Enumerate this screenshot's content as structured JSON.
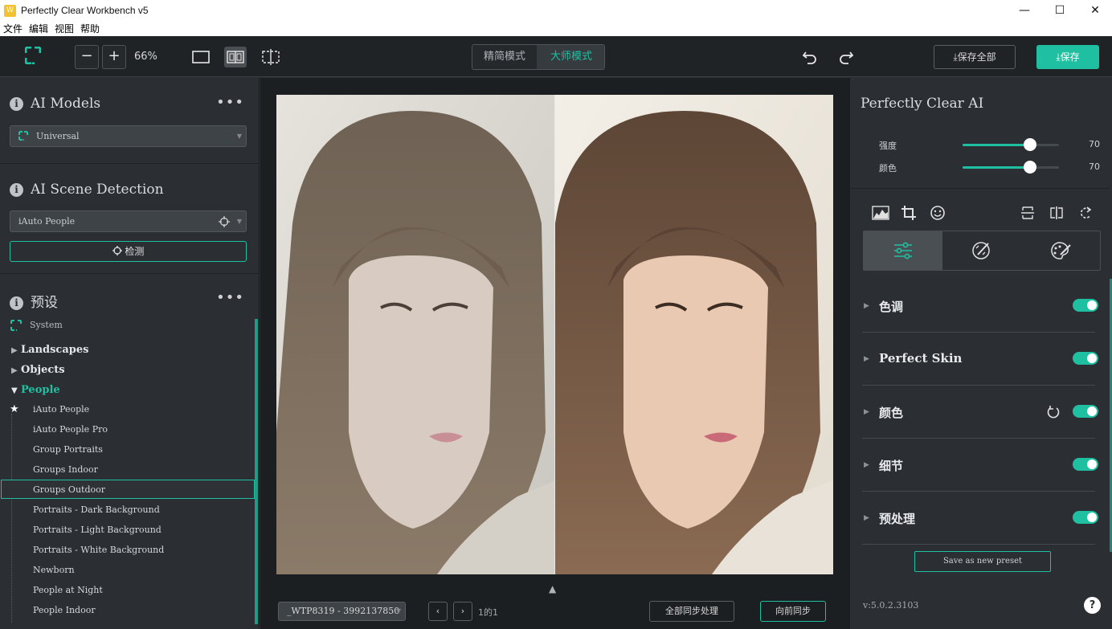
{
  "window": {
    "title": "Perfectly Clear Workbench v5",
    "app_icon_letter": "W",
    "controls": {
      "minimize": "—",
      "maximize": "☐",
      "close": "✕"
    }
  },
  "menu": [
    "文件",
    "编辑",
    "视图",
    "帮助"
  ],
  "toolbar": {
    "zoom_out": "−",
    "zoom_in": "+",
    "zoom_level": "66%",
    "mode_simple": "精简模式",
    "mode_master": "大师模式",
    "save_all": "保存全部",
    "save": "保存"
  },
  "left": {
    "ai_models": {
      "title": "AI Models",
      "selected": "Universal"
    },
    "scene_detection": {
      "title": "AI Scene Detection",
      "selected": "iAuto People",
      "detect_button": "检测"
    },
    "presets": {
      "title": "预设",
      "system_label": "System",
      "categories": [
        "Landscapes",
        "Objects",
        "People"
      ],
      "people_items": [
        "iAuto People",
        "iAuto People Pro",
        "Group Portraits",
        "Groups Indoor",
        "Groups Outdoor",
        "Portraits - Dark Background",
        "Portraits - Light Background",
        "Portraits - White Background",
        "Newborn",
        "People at Night",
        "People Indoor"
      ],
      "selected_item": "Groups Outdoor",
      "favorite_item": "iAuto People"
    }
  },
  "bottom": {
    "file_name": "_WTP8319 - 3992137850",
    "page_info": "1的1",
    "sync_all": "全部同步处理",
    "sync_forward": "向前同步"
  },
  "right": {
    "title": "Perfectly Clear AI",
    "sliders": [
      {
        "label": "强度",
        "value": "70",
        "level": 0.7
      },
      {
        "label": "颜色",
        "value": "70",
        "level": 0.7
      }
    ],
    "adjustments": [
      {
        "name": "色调",
        "enabled": true
      },
      {
        "name": "Perfect Skin",
        "enabled": true
      },
      {
        "name": "颜色",
        "enabled": true
      },
      {
        "name": "细节",
        "enabled": true
      },
      {
        "name": "预处理",
        "enabled": true
      }
    ],
    "save_preset": "Save as new preset",
    "version": "v:5.0.2.3103",
    "help": "?"
  },
  "colors": {
    "accent": "#1fc0a1",
    "panel": "#2b2f33",
    "toolbar": "#202326",
    "canvas": "#1c1f21"
  }
}
